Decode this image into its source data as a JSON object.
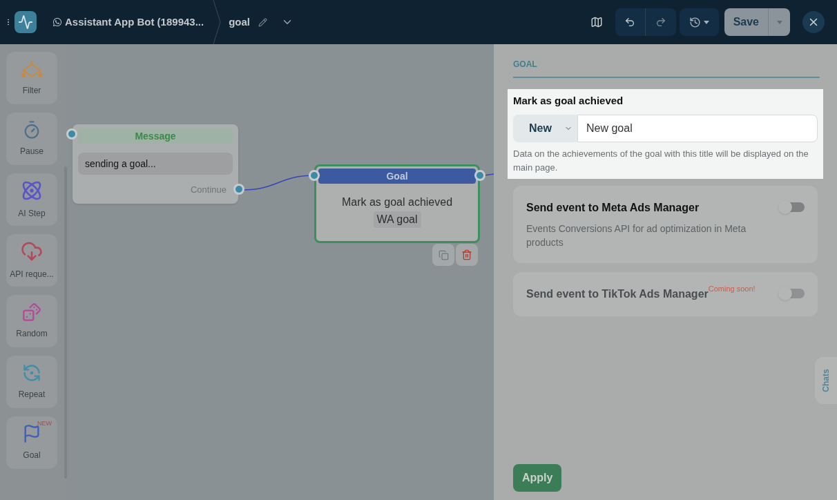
{
  "header": {
    "bot_name": "Assistant App Bot (189943...",
    "flow_name": "goal",
    "save_label": "Save"
  },
  "tools": [
    {
      "kind": "filter",
      "label": "Filter"
    },
    {
      "kind": "pause",
      "label": "Pause"
    },
    {
      "kind": "ai",
      "label": "AI Step"
    },
    {
      "kind": "api",
      "label": "API reque..."
    },
    {
      "kind": "random",
      "label": "Random"
    },
    {
      "kind": "repeat",
      "label": "Repeat"
    },
    {
      "kind": "goal",
      "label": "Goal",
      "badge": "NEW"
    }
  ],
  "nodes": [
    {
      "kind": "message",
      "title": "Message",
      "text": "sending a goal...",
      "port_label": "Continue"
    },
    {
      "kind": "goal",
      "title": "Goal",
      "text": "Mark as goal achieved",
      "tag": "WA goal"
    }
  ],
  "panel": {
    "tab": "GOAL",
    "field_label": "Mark as goal achieved",
    "select_value": "New",
    "input_value": "New goal",
    "hint": "Data on the achievements of the goal with this title will be displayed on the main page.",
    "options": [
      {
        "title": "Send event to Meta Ads Manager",
        "description": "Events Conversions API for ad optimization in Meta products",
        "on": false,
        "disabled": false
      },
      {
        "title": "Send event to TikTok Ads Manager",
        "badge": "Coming soon!",
        "on": false,
        "disabled": true
      }
    ],
    "apply_label": "Apply",
    "chats_label": "Chats"
  }
}
